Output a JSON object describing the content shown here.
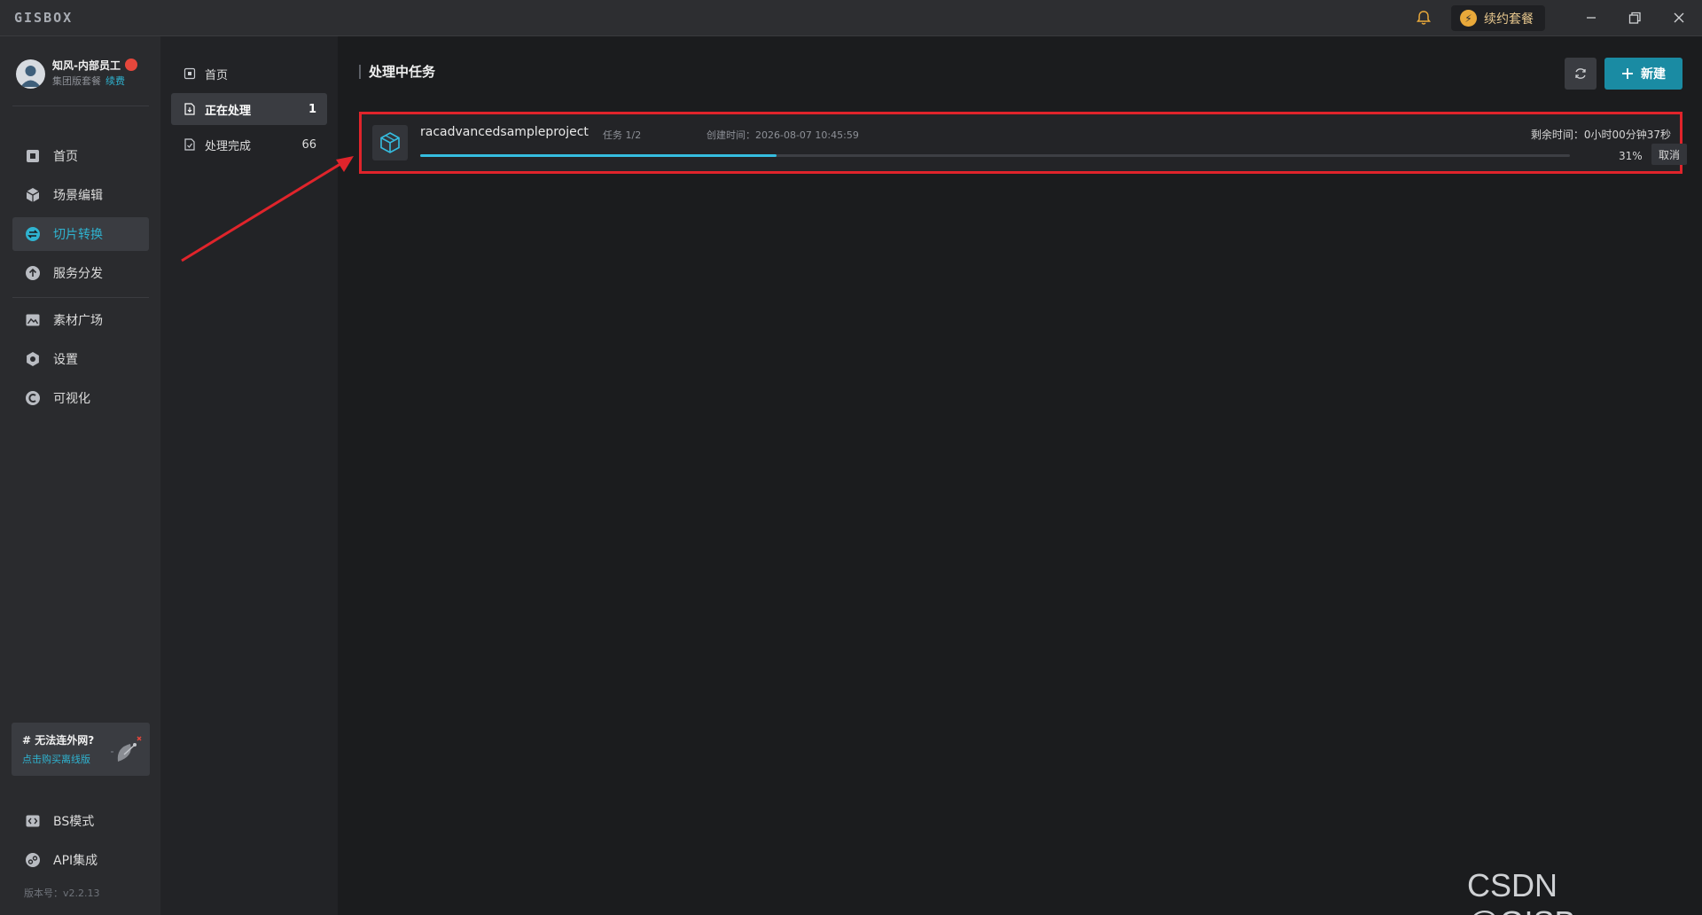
{
  "titlebar": {
    "logo": "GISBOX",
    "upgrade_label": "续约套餐",
    "icons": [
      "bell-icon",
      "bolt-icon",
      "minimize-icon",
      "restore-icon",
      "close-icon"
    ]
  },
  "user": {
    "name": "知风-内部员工",
    "plan": "集团版套餐",
    "renew": "续费"
  },
  "sidebar": {
    "items": [
      {
        "label": "首页",
        "icon": "home-icon"
      },
      {
        "label": "场景编辑",
        "icon": "cube-icon"
      },
      {
        "label": "切片转换",
        "icon": "swap-icon",
        "active": true
      },
      {
        "label": "服务分发",
        "icon": "upload-icon"
      },
      {
        "label": "素材广场",
        "icon": "image-icon"
      },
      {
        "label": "设置",
        "icon": "gear-icon"
      },
      {
        "label": "可视化",
        "icon": "visual-icon"
      }
    ],
    "bottom_items": [
      {
        "label": "BS模式",
        "icon": "code-icon"
      },
      {
        "label": "API集成",
        "icon": "api-icon"
      }
    ],
    "promo": {
      "title": "# 无法连外网?",
      "link": "点击购买离线版"
    },
    "version": "版本号：v2.2.13"
  },
  "subnav": {
    "items": [
      {
        "label": "首页",
        "count": ""
      },
      {
        "label": "正在处理",
        "count": "1",
        "active": true
      },
      {
        "label": "处理完成",
        "count": "66"
      }
    ]
  },
  "main": {
    "title": "处理中任务",
    "new_label": "新建",
    "task": {
      "name": "racadvancedsampleproject",
      "step": "任务 1/2",
      "created": "创建时间：2026-08-07 10:45:59",
      "remaining": "剩余时间：0小时00分钟37秒",
      "progress": 0.31,
      "percent": "31%",
      "cancel_label": "取消"
    }
  },
  "watermark": "CSDN @GISBox",
  "colors": {
    "accent": "#2fb3d0",
    "primary_button": "#1a8ba3",
    "highlight_border": "#e0242b",
    "progress": "#35bde0"
  }
}
